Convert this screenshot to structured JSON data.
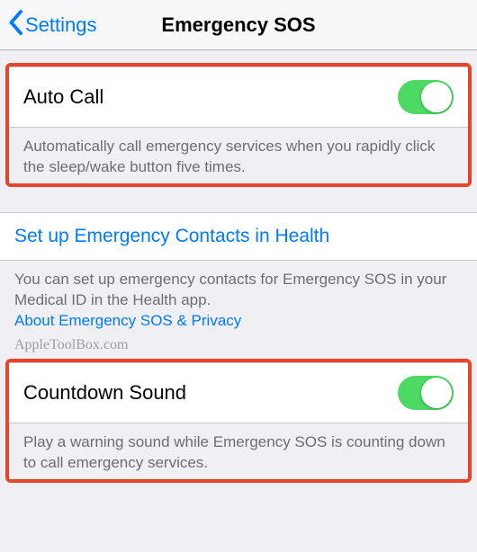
{
  "nav": {
    "back_label": "Settings",
    "title": "Emergency SOS"
  },
  "auto_call": {
    "label": "Auto Call",
    "on": true,
    "footer": "Automatically call emergency services when you rapidly click the sleep/wake button five times."
  },
  "setup_link": "Set up Emergency Contacts in Health",
  "setup_footer": "You can set up emergency contacts for Emergency SOS in your Medical ID in the Health app.",
  "privacy_link": "About Emergency SOS & Privacy",
  "watermark": "AppleToolBox.com",
  "countdown": {
    "label": "Countdown Sound",
    "on": true,
    "footer": "Play a warning sound while Emergency SOS is counting down to call emergency services."
  }
}
